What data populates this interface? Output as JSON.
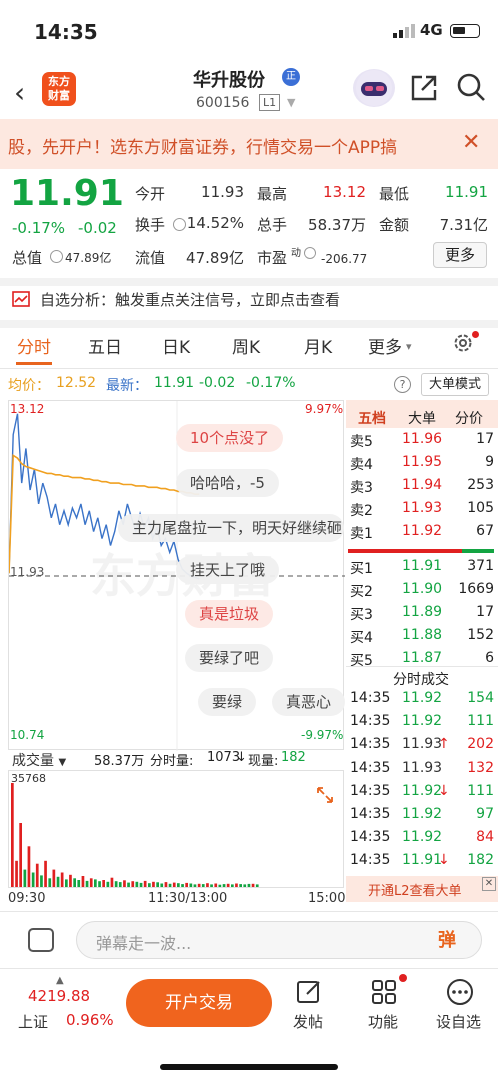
{
  "status": {
    "time": "14:35",
    "network": "4G"
  },
  "nav": {
    "logo_line1": "东方",
    "logo_line2": "财富",
    "title": "华升股份",
    "title_badge": "正",
    "code": "600156",
    "level": "L1"
  },
  "banner": {
    "text": "股，先开户！选东方财富证券，行情交易一个APP搞"
  },
  "quote": {
    "price": "11.91",
    "pct": "-0.17%",
    "change": "-0.02",
    "open_label": "今开",
    "open": "11.93",
    "high_label": "最高",
    "high": "13.12",
    "low_label": "最低",
    "low": "11.91",
    "turnover_label": "换手",
    "turnover": "14.52%",
    "volume_label": "总手",
    "volume": "58.37万",
    "amount_label": "金额",
    "amount": "7.31亿",
    "mcap_label": "总值",
    "mcap": "47.89亿",
    "float_label": "流值",
    "float": "47.89亿",
    "pe_label": "市盈",
    "pe_sup": "动",
    "pe": "-206.77",
    "more": "更多"
  },
  "analysis": {
    "text": "自选分析：触发重点关注信号，立即点击查看"
  },
  "tabs": [
    {
      "label": "分时"
    },
    {
      "label": "五日"
    },
    {
      "label": "日K"
    },
    {
      "label": "周K"
    },
    {
      "label": "月K"
    },
    {
      "label": "更多"
    }
  ],
  "avg": {
    "avg_label": "均价：",
    "avg_value": "12.52",
    "latest_label": "最新：",
    "latest_value": "11.91",
    "chg": "-0.02",
    "pct": "-0.17%",
    "help": "?",
    "big_order": "大单模式"
  },
  "chart_data": {
    "type": "line",
    "x_ticks": [
      "09:30",
      "11:30/13:00",
      "15:00"
    ],
    "y_left": {
      "top": "13.12",
      "mid": "11.93",
      "bottom": "10.74"
    },
    "y_right": {
      "top": "9.97%",
      "bottom": "-9.97%"
    },
    "ylim": [
      10.74,
      13.12
    ],
    "series": [
      {
        "role": "price",
        "color": "#3a73c8",
        "values": [
          11.95,
          12.95,
          13.1,
          12.6,
          12.85,
          12.55,
          12.7,
          12.45,
          12.6,
          12.5,
          12.35,
          12.45,
          12.3,
          12.4,
          12.3,
          12.42,
          12.35,
          12.45,
          12.3,
          12.4,
          12.25,
          12.35,
          12.2,
          12.3,
          12.15,
          12.25,
          12.4,
          12.3,
          12.45,
          12.35,
          12.25,
          12.38,
          12.28,
          12.35,
          12.2,
          12.28,
          12.15,
          12.2,
          12.1,
          12.18,
          12.05,
          11.98,
          11.95,
          11.93,
          11.92,
          11.91
        ]
      },
      {
        "role": "average",
        "color": "#f0a020",
        "values": [
          11.95,
          12.8,
          12.78,
          12.74,
          12.72,
          12.71,
          12.7,
          12.69,
          12.68,
          12.67,
          12.67,
          12.66,
          12.66,
          12.65,
          12.65,
          12.64,
          12.64,
          12.64,
          12.63,
          12.63,
          12.62,
          12.62,
          12.61,
          12.61,
          12.6,
          12.6,
          12.6,
          12.59,
          12.59,
          12.59,
          12.58,
          12.58,
          12.58,
          12.57,
          12.57,
          12.57,
          12.56,
          12.56,
          12.55,
          12.55,
          12.54,
          12.54,
          12.53,
          12.53,
          12.52,
          12.52
        ]
      }
    ],
    "volume": {
      "label": "成交量",
      "max": "35768",
      "total_label": "58.37万",
      "tick_label": "分时量:",
      "tick_value": "1073",
      "now_label": "现量:",
      "now_value": "182",
      "bars": [
        35768,
        9000,
        22000,
        6000,
        14000,
        5000,
        8000,
        4000,
        9000,
        3000,
        6000,
        3500,
        5000,
        2600,
        4200,
        3000,
        2400,
        3800,
        2100,
        3000,
        2600,
        2000,
        2400,
        1800,
        3200,
        2000,
        1700,
        2300,
        1500,
        2000,
        1800,
        1400,
        2100,
        1300,
        1800,
        1600,
        1200,
        1700,
        1100,
        1500,
        1300,
        1000,
        1400,
        1200,
        900,
        1100,
        1000,
        1300,
        900,
        1200,
        800,
        1000,
        1100,
        900,
        1200,
        1000,
        900,
        1073,
        1100,
        900
      ],
      "colors": [
        "#e02020",
        "#e02020",
        "#e02020",
        "#13a442",
        "#e02020",
        "#13a442",
        "#e02020",
        "#13a442",
        "#e02020",
        "#13a442",
        "#e02020",
        "#13a442",
        "#e02020",
        "#13a442",
        "#e02020",
        "#13a442",
        "#13a442",
        "#e02020",
        "#13a442",
        "#e02020",
        "#13a442",
        "#13a442",
        "#e02020",
        "#13a442",
        "#e02020",
        "#13a442",
        "#13a442",
        "#e02020",
        "#13a442",
        "#e02020",
        "#13a442",
        "#13a442",
        "#e02020",
        "#13a442",
        "#e02020",
        "#13a442",
        "#13a442",
        "#e02020",
        "#13a442",
        "#e02020",
        "#13a442",
        "#13a442",
        "#e02020",
        "#13a442",
        "#13a442",
        "#e02020",
        "#13a442",
        "#e02020",
        "#13a442",
        "#e02020",
        "#13a442",
        "#13a442",
        "#e02020",
        "#13a442",
        "#e02020",
        "#13a442",
        "#13a442",
        "#13a442",
        "#e02020",
        "#13a442"
      ]
    }
  },
  "watermark": "东方财富",
  "danmu": [
    {
      "text": "10个点没了",
      "pink": true
    },
    {
      "text": "哈哈哈，-5",
      "pink": false
    },
    {
      "text": "主力尾盘拉一下，明天好继续砸",
      "pink": false
    },
    {
      "text": "挂天上了哦",
      "pink": false
    },
    {
      "text": "真是垃圾",
      "pink": true
    },
    {
      "text": "要绿了吧",
      "pink": false
    },
    {
      "text": "要绿",
      "pink": false
    },
    {
      "text": "真恶心",
      "pink": false
    }
  ],
  "book": {
    "tabs": [
      "五档",
      "大单",
      "分价"
    ],
    "asks": [
      {
        "label": "卖5",
        "price": "11.96",
        "vol": "17"
      },
      {
        "label": "卖4",
        "price": "11.95",
        "vol": "9"
      },
      {
        "label": "卖3",
        "price": "11.94",
        "vol": "253"
      },
      {
        "label": "卖2",
        "price": "11.93",
        "vol": "105"
      },
      {
        "label": "卖1",
        "price": "11.92",
        "vol": "67"
      }
    ],
    "bids": [
      {
        "label": "买1",
        "price": "11.91",
        "vol": "371"
      },
      {
        "label": "买2",
        "price": "11.90",
        "vol": "1669"
      },
      {
        "label": "买3",
        "price": "11.89",
        "vol": "17"
      },
      {
        "label": "买4",
        "price": "11.88",
        "vol": "152"
      },
      {
        "label": "买5",
        "price": "11.87",
        "vol": "6"
      }
    ],
    "ticks_title": "分时成交",
    "ticks": [
      {
        "time": "14:35",
        "price": "11.92",
        "arrow": "",
        "vol": "154",
        "vcolor": "#13a442",
        "pcolor": "#13a442"
      },
      {
        "time": "14:35",
        "price": "11.92",
        "arrow": "",
        "vol": "111",
        "vcolor": "#13a442",
        "pcolor": "#13a442"
      },
      {
        "time": "14:35",
        "price": "11.93",
        "arrow": "↑",
        "vol": "202",
        "vcolor": "#e02020",
        "pcolor": "#333333"
      },
      {
        "time": "14:35",
        "price": "11.93",
        "arrow": "",
        "vol": "132",
        "vcolor": "#e02020",
        "pcolor": "#333333"
      },
      {
        "time": "14:35",
        "price": "11.92",
        "arrow": "↓",
        "vol": "111",
        "vcolor": "#13a442",
        "pcolor": "#13a442"
      },
      {
        "time": "14:35",
        "price": "11.92",
        "arrow": "",
        "vol": "97",
        "vcolor": "#13a442",
        "pcolor": "#13a442"
      },
      {
        "time": "14:35",
        "price": "11.92",
        "arrow": "",
        "vol": "84",
        "vcolor": "#e02020",
        "pcolor": "#13a442"
      },
      {
        "time": "14:35",
        "price": "11.91",
        "arrow": "↓",
        "vol": "182",
        "vcolor": "#13a442",
        "pcolor": "#13a442"
      }
    ],
    "l2": "开通L2查看大单"
  },
  "comment": {
    "placeholder": "弹幕走一波...",
    "dan": "弹"
  },
  "bottom": {
    "index_value": "4219.88",
    "index_name": "上证",
    "index_pct": "0.96%",
    "open_account": "开户交易",
    "post": "发帖",
    "function": "功能",
    "settings": "设自选"
  }
}
